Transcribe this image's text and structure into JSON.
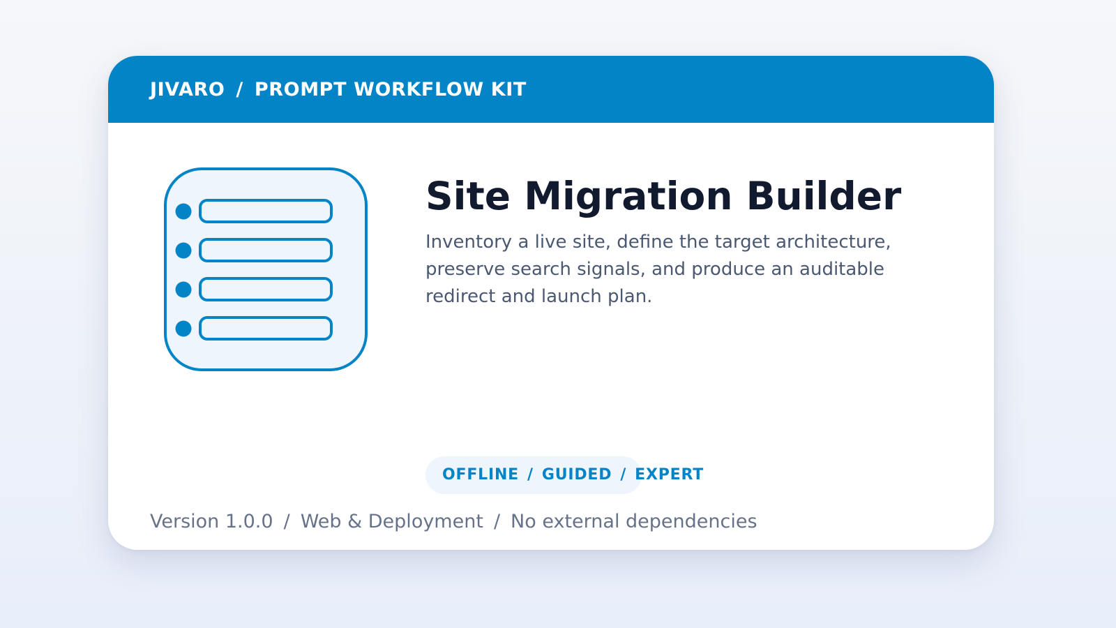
{
  "header": {
    "brand": "JIVARO",
    "separator": "/",
    "product": "PROMPT WORKFLOW KIT"
  },
  "hero": {
    "icon": "list-checklist-icon",
    "title": "Site Migration Builder",
    "description": "Inventory a live site, define the target architecture, preserve search signals, and produce an auditable redirect and launch plan."
  },
  "tags": [
    "OFFLINE",
    "GUIDED",
    "EXPERT"
  ],
  "tag_separator": "/",
  "footer": {
    "version": "Version 1.0.0",
    "category": "Web & Deployment",
    "dependencies": "No external dependencies",
    "separator": "/"
  },
  "colors": {
    "accent": "#0384c7",
    "title": "#111a2e",
    "body_text": "#4b5872",
    "muted_text": "#66728a",
    "tag_background": "#eef5fc",
    "icon_fill": "#eef5fd"
  }
}
